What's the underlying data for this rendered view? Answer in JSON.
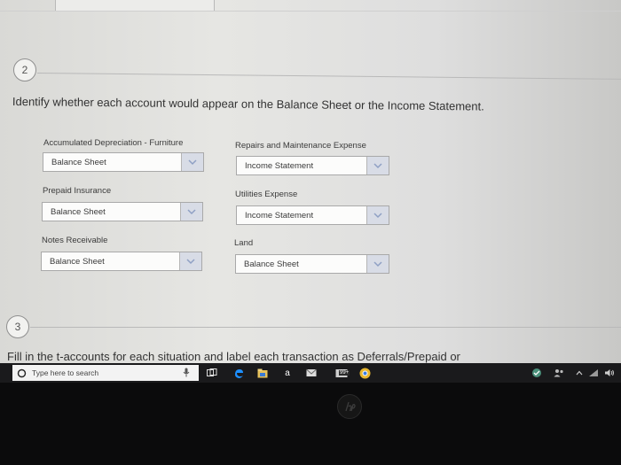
{
  "question2": {
    "number": "2",
    "prompt": "Identify whether each account would appear on the Balance Sheet or the Income Statement."
  },
  "accounts": [
    {
      "label": "Accumulated Depreciation - Furniture",
      "value": "Balance Sheet"
    },
    {
      "label": "Repairs and Maintenance Expense",
      "value": "Income Statement"
    },
    {
      "label": "Prepaid Insurance",
      "value": "Balance Sheet"
    },
    {
      "label": "Utilities Expense",
      "value": "Income Statement"
    },
    {
      "label": "Notes Receivable",
      "value": "Balance Sheet"
    },
    {
      "label": "Land",
      "value": "Balance Sheet"
    }
  ],
  "question3": {
    "number": "3",
    "prompt": "Fill in the t-accounts for each situation and label each transaction as Deferrals/Prepaid or"
  },
  "taskbar": {
    "search_placeholder": "Type here to search",
    "store_letter": "a",
    "badge": "99+"
  },
  "colors": {
    "page_bg": "#e4e4e1",
    "dropdown_arrow_bg": "#d8dce6",
    "dropdown_chevron": "#8fa0c4",
    "taskbar_bg": "#1a1a1c",
    "edge_blue": "#1e90ff"
  }
}
